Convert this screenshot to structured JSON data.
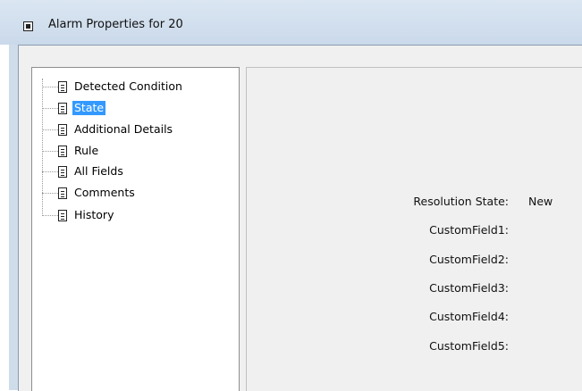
{
  "window": {
    "title": "Alarm Properties for 20"
  },
  "tree": {
    "items": [
      {
        "label": "Detected Condition",
        "selected": false
      },
      {
        "label": "State",
        "selected": true
      },
      {
        "label": "Additional Details",
        "selected": false
      },
      {
        "label": "Rule",
        "selected": false
      },
      {
        "label": "All Fields",
        "selected": false
      },
      {
        "label": "Comments",
        "selected": false
      },
      {
        "label": "History",
        "selected": false
      }
    ]
  },
  "state": {
    "fields": [
      {
        "label": "Resolution State:",
        "value": "New"
      },
      {
        "label": "CustomField1:",
        "value": ""
      },
      {
        "label": "CustomField2:",
        "value": ""
      },
      {
        "label": "CustomField3:",
        "value": ""
      },
      {
        "label": "CustomField4:",
        "value": ""
      },
      {
        "label": "CustomField5:",
        "value": ""
      }
    ]
  },
  "icons": {
    "system_menu": "system-menu-icon",
    "tree_item": "document-icon"
  },
  "colors": {
    "selection": "#3399ff",
    "titlebar": "#cad9ea",
    "panel_bg": "#f0f0f0"
  }
}
